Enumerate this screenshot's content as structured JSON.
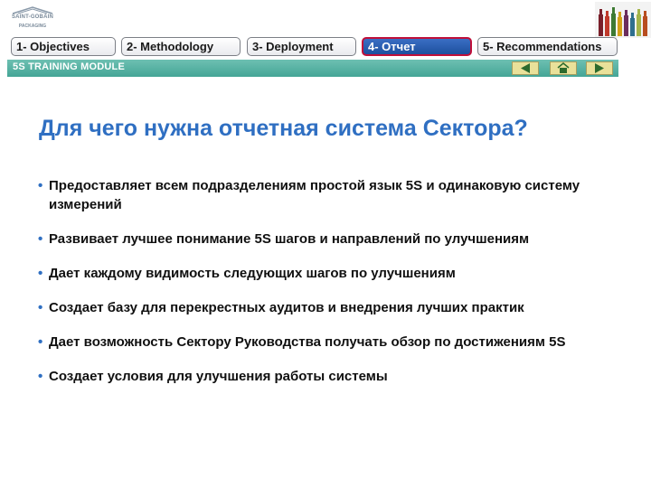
{
  "logo": {
    "brand": "SAINT-GOBAIN",
    "sub": "PACKAGING"
  },
  "tabs": [
    {
      "label": "1- Objectives",
      "active": false
    },
    {
      "label": "2- Methodology",
      "active": false
    },
    {
      "label": "3- Deployment",
      "active": false
    },
    {
      "label": "4- Отчет",
      "active": true
    },
    {
      "label": "5- Recommendations",
      "active": false
    }
  ],
  "header": {
    "module_label": "5S TRAINING MODULE"
  },
  "nav": {
    "back_icon": "arrow-left-icon",
    "home_icon": "home-icon",
    "forward_icon": "arrow-right-icon"
  },
  "main": {
    "title": "Для чего нужна отчетная система Сектора?",
    "bullets": [
      "Предоставляет всем подразделениям простой язык 5S и одинаковую систему измерений",
      "Развивает лучшее понимание 5S шагов и направлений по улучшениям",
      "Дает каждому видимость следующих шагов по улучшениям",
      "Создает базу для перекрестных аудитов и внедрения лучших практик",
      "Дает возможность Сектору Руководства получать обзор по достижениям 5S",
      "Создает условия для улучшения работы системы"
    ]
  },
  "colors": {
    "accent": "#2f6fc2",
    "module_bar": "#45a596",
    "active_tab": "#1d4f9e",
    "active_border": "#c0103a",
    "nav_button": "#e9e19a"
  }
}
